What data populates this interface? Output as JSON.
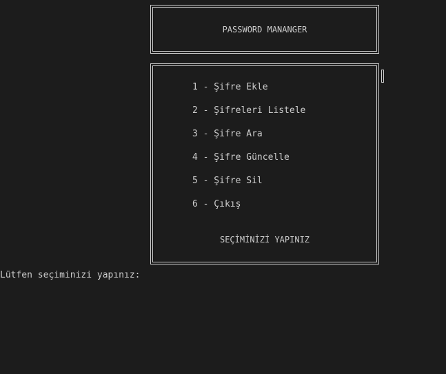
{
  "header": {
    "title": "PASSWORD MANANGER"
  },
  "menu": {
    "items": [
      "1 - Şifre Ekle",
      "2 - Şifreleri Listele",
      "3 - Şifre Ara",
      "4 - Şifre Güncelle",
      "5 - Şifre Sil",
      "6 - Çıkış"
    ],
    "prompt": "SEÇİMİNİZİ YAPINIZ"
  },
  "console": {
    "input_prompt": "Lütfen seçiminizi yapınız:"
  }
}
